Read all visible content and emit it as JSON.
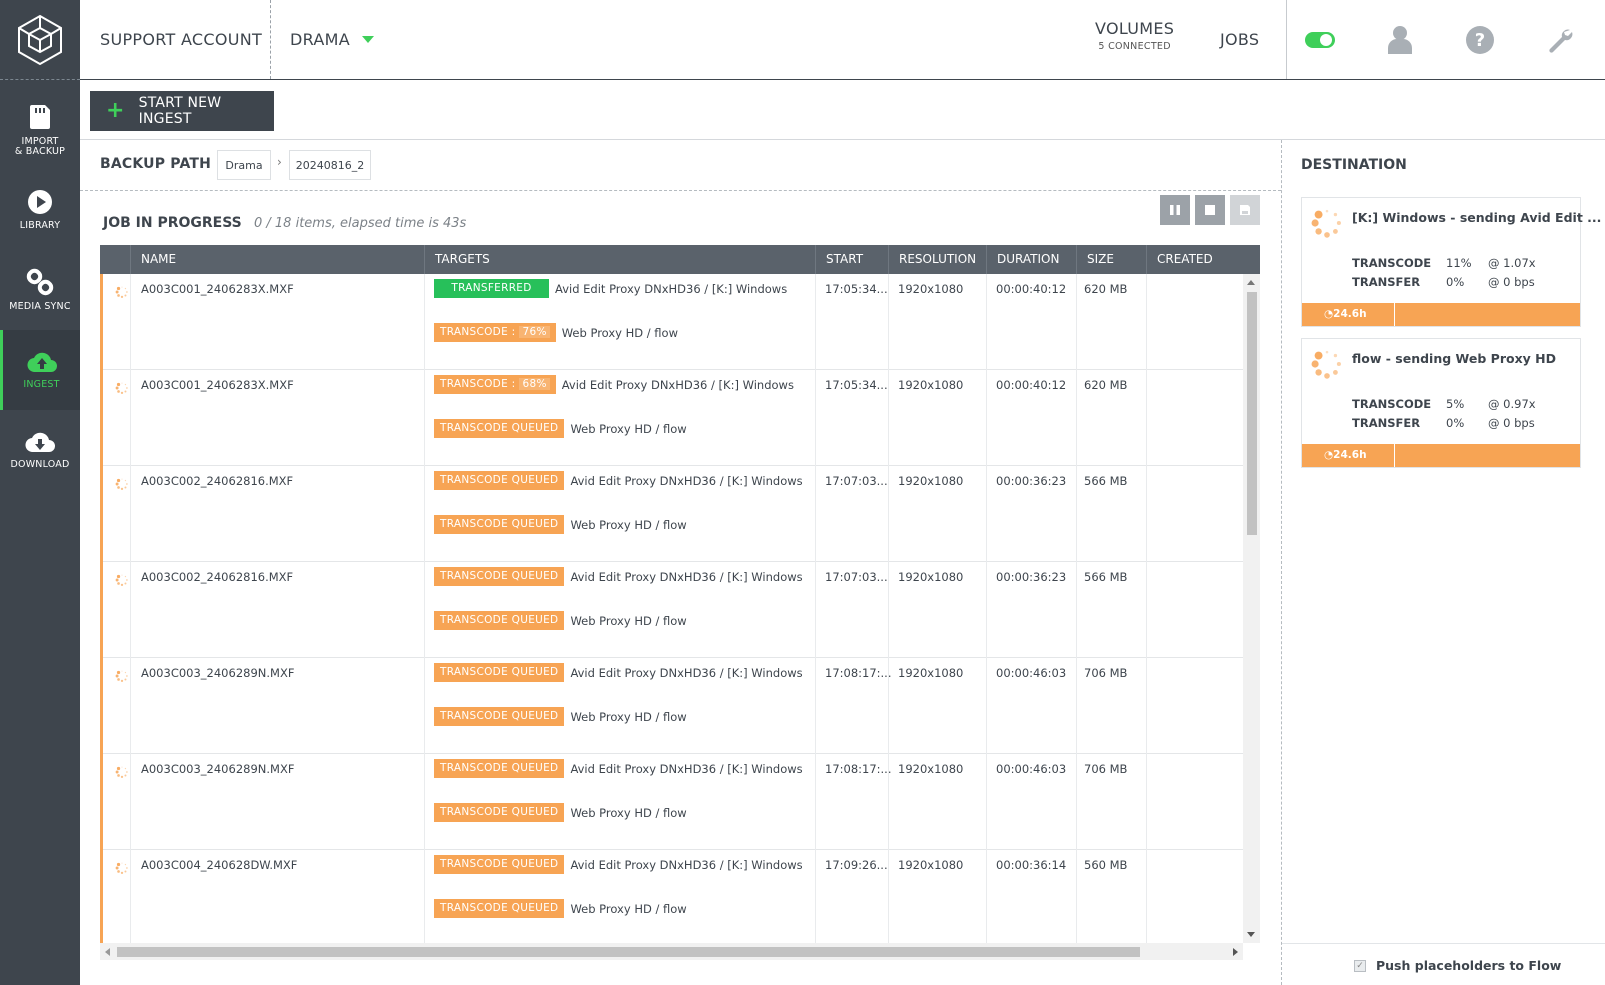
{
  "nav": {
    "items": [
      {
        "label": "IMPORT\n& BACKUP",
        "label_top": "IMPORT",
        "label_bottom": "& BACKUP",
        "icon": "sd-card-icon"
      },
      {
        "label": "LIBRARY",
        "icon": "play-icon"
      },
      {
        "label": "MEDIA SYNC",
        "icon": "link-icon"
      },
      {
        "label": "INGEST",
        "icon": "cloud-upload-icon",
        "active": true
      },
      {
        "label": "DOWNLOAD",
        "icon": "cloud-download-icon"
      }
    ]
  },
  "header": {
    "account": "SUPPORT ACCOUNT",
    "project": "DRAMA",
    "volumes_label": "VOLUMES",
    "volumes_sub": "5 CONNECTED",
    "jobs_label": "JOBS",
    "toggle_on": true
  },
  "toolbar": {
    "start_ingest": "START NEW INGEST"
  },
  "backup_path": {
    "label": "BACKUP PATH",
    "crumbs": [
      "Drama",
      "20240816_2"
    ]
  },
  "job": {
    "title": "JOB IN PROGRESS",
    "status": "0 / 18  items, elapsed time is 43s"
  },
  "table": {
    "columns": [
      "NAME",
      "TARGETS",
      "START",
      "RESOLUTION",
      "DURATION",
      "SIZE",
      "CREATED"
    ],
    "rows": [
      {
        "name": "A003C001_2406283X.MXF",
        "start": "17:05:34...",
        "resolution": "1920x1080",
        "duration": "00:00:40:12",
        "size": "620 MB",
        "t1_badge": "TRANSFERRED",
        "t1_kind": "green",
        "t1_label": "Avid Edit Proxy DNxHD36 / [K:] Windows",
        "t2_badge": "TRANSCODE :",
        "t2_pct": "76%",
        "t2_label": "Web Proxy HD / flow"
      },
      {
        "name": "A003C001_2406283X.MXF",
        "start": "17:05:34...",
        "resolution": "1920x1080",
        "duration": "00:00:40:12",
        "size": "620 MB",
        "t1_badge": "TRANSCODE :",
        "t1_pct": "68%",
        "t1_label": "Avid Edit Proxy DNxHD36 / [K:] Windows",
        "t2_badge": "TRANSCODE  QUEUED",
        "t2_label": "Web Proxy HD / flow"
      },
      {
        "name": "A003C002_24062816.MXF",
        "start": "17:07:03...",
        "resolution": "1920x1080",
        "duration": "00:00:36:23",
        "size": "566 MB",
        "t1_badge": "TRANSCODE  QUEUED",
        "t1_label": "Avid Edit Proxy DNxHD36 / [K:] Windows",
        "t2_badge": "TRANSCODE  QUEUED",
        "t2_label": "Web Proxy HD / flow"
      },
      {
        "name": "A003C002_24062816.MXF",
        "start": "17:07:03...",
        "resolution": "1920x1080",
        "duration": "00:00:36:23",
        "size": "566 MB",
        "t1_badge": "TRANSCODE  QUEUED",
        "t1_label": "Avid Edit Proxy DNxHD36 / [K:] Windows",
        "t2_badge": "TRANSCODE  QUEUED",
        "t2_label": "Web Proxy HD / flow"
      },
      {
        "name": "A003C003_2406289N.MXF",
        "start": "17:08:17:...",
        "resolution": "1920x1080",
        "duration": "00:00:46:03",
        "size": "706 MB",
        "t1_badge": "TRANSCODE  QUEUED",
        "t1_label": "Avid Edit Proxy DNxHD36 / [K:] Windows",
        "t2_badge": "TRANSCODE  QUEUED",
        "t2_label": "Web Proxy HD / flow"
      },
      {
        "name": "A003C003_2406289N.MXF",
        "start": "17:08:17:...",
        "resolution": "1920x1080",
        "duration": "00:00:46:03",
        "size": "706 MB",
        "t1_badge": "TRANSCODE  QUEUED",
        "t1_label": "Avid Edit Proxy DNxHD36 / [K:] Windows",
        "t2_badge": "TRANSCODE  QUEUED",
        "t2_label": "Web Proxy HD / flow"
      },
      {
        "name": "A003C004_240628DW.MXF",
        "start": "17:09:26...",
        "resolution": "1920x1080",
        "duration": "00:00:36:14",
        "size": "560 MB",
        "t1_badge": "TRANSCODE  QUEUED",
        "t1_label": "Avid Edit Proxy DNxHD36 / [K:] Windows",
        "t2_badge": "TRANSCODE  QUEUED",
        "t2_label": "Web Proxy HD / flow"
      }
    ]
  },
  "destination": {
    "label": "DESTINATION",
    "cards": [
      {
        "title": "[K:] Windows - sending Avid Edit ...",
        "transcode_label": "TRANSCODE",
        "transcode_pct": "11%",
        "transcode_rate": "@ 1.07x",
        "transfer_label": "TRANSFER",
        "transfer_pct": "0%",
        "transfer_rate": "@ 0 bps",
        "eta": "24.6h"
      },
      {
        "title": "flow - sending Web Proxy HD",
        "transcode_label": "TRANSCODE",
        "transcode_pct": "5%",
        "transcode_rate": "@ 0.97x",
        "transfer_label": "TRANSFER",
        "transfer_pct": "0%",
        "transfer_rate": "@ 0 bps",
        "eta": "24.6h"
      }
    ],
    "push_label": "Push placeholders to Flow",
    "push_checked": true
  },
  "colors": {
    "accent_green": "#3fcf5a",
    "orange": "#f7a454",
    "sidebar": "#3e454d",
    "header_row": "#5a626b"
  }
}
